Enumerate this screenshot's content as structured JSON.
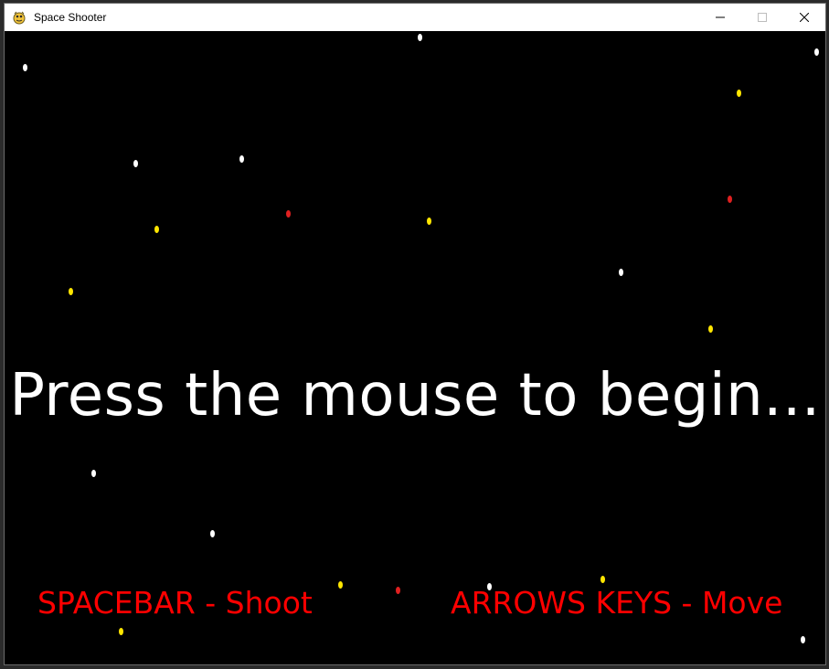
{
  "window": {
    "title": "Space Shooter",
    "icon": "pygame-snake-icon",
    "controls": [
      "minimize-icon",
      "maximize-icon",
      "close-icon"
    ]
  },
  "game": {
    "start_prompt": "Press the mouse to begin...",
    "hints": {
      "shoot": "SPACEBAR - Shoot",
      "move": "ARROWS KEYS - Move"
    },
    "colors": {
      "background": "#000000",
      "headline": "#ffffff",
      "hint": "#ff0000",
      "star_white": "#ffffff",
      "star_yellow": "#ffe600",
      "star_red": "#e02020"
    }
  }
}
